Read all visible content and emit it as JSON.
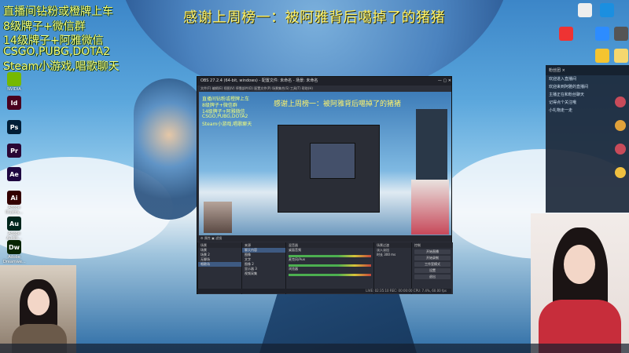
{
  "overlay": {
    "lines": [
      "直播间钻粉或橙牌上车",
      "8级牌子+微信群",
      "14级牌子+阿雅微信",
      "CSGO,PUBG,DOTA2",
      "Steam小游戏,唱歌聊天"
    ],
    "banner": "感谢上周榜一：被阿雅背后噶掉了的猪猪"
  },
  "desktop_icons_left": [
    {
      "name": "nvidia-icon",
      "label": "NVIDIA",
      "color": "#76b900",
      "text": ""
    },
    {
      "name": "indesign-icon",
      "label": "",
      "color": "#49021f",
      "text": "Id"
    },
    {
      "name": "photoshop-icon",
      "label": "",
      "color": "#001e36",
      "text": "Ps"
    },
    {
      "name": "premiere-icon",
      "label": "",
      "color": "#2a0634",
      "text": "Pr"
    },
    {
      "name": "after-effects-icon",
      "label": "",
      "color": "#1f0740",
      "text": "Ae"
    },
    {
      "name": "illustrator-icon",
      "label": "Adobe Illustra...",
      "color": "#330000",
      "text": "Ai"
    },
    {
      "name": "audition-icon",
      "label": "Adobe Auditi...",
      "color": "#00261d",
      "text": "Au"
    },
    {
      "name": "dreamweaver-icon",
      "label": "Adobe Dreamwe...",
      "color": "#072401",
      "text": "Dw"
    }
  ],
  "obs": {
    "title": "OBS 27.2.4 (64-bit, windows) - 配置文件: 未命名 - 场景: 未命名",
    "menu": "文件(F)  编辑(E)  视图(V)  停靠部件(D)  配置文件(P)  场景集合(S)  工具(T)  帮助(H)",
    "scenes_header": "场景",
    "sources_header": "来源",
    "mixer_header": "混音器",
    "transitions_header": "场景过渡",
    "controls_header": "控制",
    "scenes": [
      "场景",
      "场景 2",
      "无聊场",
      "唱歌场"
    ],
    "sources": [
      "聊天内容",
      "图像",
      "文字",
      "图像 2",
      "显示器 3",
      "视频采集"
    ],
    "mixer": [
      "桌面音频",
      "麦克风/Aux",
      "浏览器"
    ],
    "transition": "淡入淡出",
    "duration": "时长 300 ms",
    "controls": [
      "开始直播",
      "开始录制",
      "工作室模式",
      "设置",
      "退出"
    ],
    "status": "LIVE: 02:35:10  REC: 00:00:00  CPU: 7.4%, 60.00 fps"
  },
  "chat": {
    "header": "粉丝团  ×",
    "messages": [
      "欢迎进入直播间",
      "欢迎来到阿雅的直播间",
      "主播正在和粉丝聊天",
      "记得点个关注哦",
      "小礼物走一走"
    ]
  }
}
